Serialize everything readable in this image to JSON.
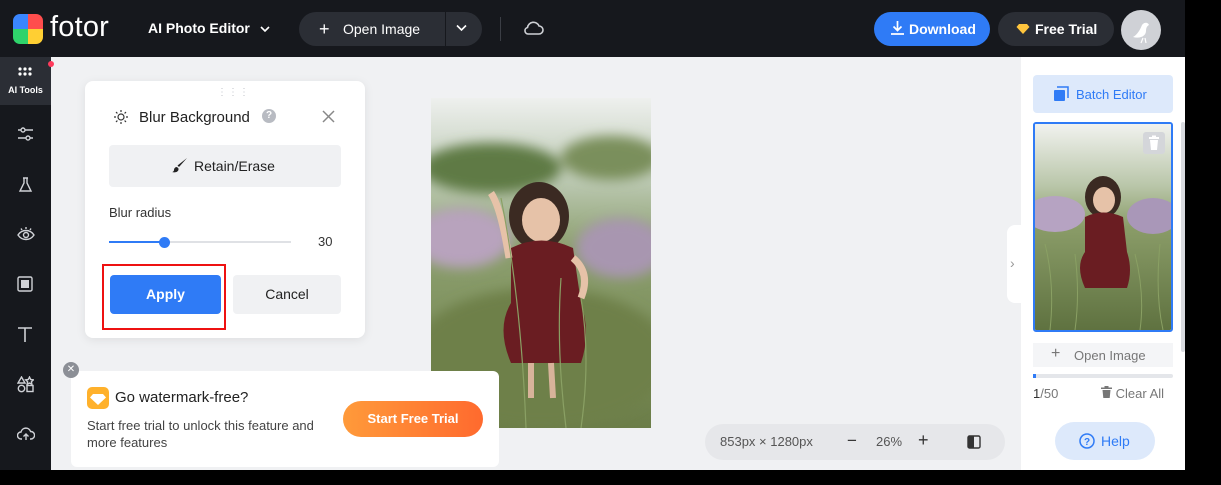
{
  "topbar": {
    "logo_text": "fotor",
    "app_switch": "AI Photo Editor",
    "open_image": "Open Image",
    "download": "Download",
    "free_trial": "Free Trial"
  },
  "sidebar": {
    "items": [
      {
        "label": "AI Tools",
        "icon": "grid-icon"
      },
      {
        "label": "",
        "icon": "sliders-icon"
      },
      {
        "label": "",
        "icon": "flask-icon"
      },
      {
        "label": "",
        "icon": "eye-icon"
      },
      {
        "label": "",
        "icon": "frame-icon"
      },
      {
        "label": "",
        "icon": "text-icon"
      },
      {
        "label": "",
        "icon": "elements-icon"
      },
      {
        "label": "",
        "icon": "cloud-upload-icon"
      }
    ]
  },
  "panel": {
    "title": "Blur Background",
    "retain_erase": "Retain/Erase",
    "blur_radius_label": "Blur radius",
    "blur_radius_value": "30",
    "blur_radius_fraction": 0.3,
    "apply": "Apply",
    "cancel": "Cancel"
  },
  "promo": {
    "title": "Go watermark-free?",
    "description": "Start free trial to unlock this feature and more features",
    "button": "Start Free Trial"
  },
  "zoombar": {
    "dimensions": "853px × 1280px",
    "zoom": "26%"
  },
  "right_panel": {
    "batch_editor": "Batch Editor",
    "open_image": "Open Image",
    "count_current": "1",
    "count_total": "/50",
    "clear_all": "Clear All",
    "help": "Help"
  },
  "colors": {
    "accent": "#2f7bf6",
    "topbar_bg": "#16181d",
    "highlight": "#ee1111",
    "promo_orange": "#ff7a30"
  }
}
